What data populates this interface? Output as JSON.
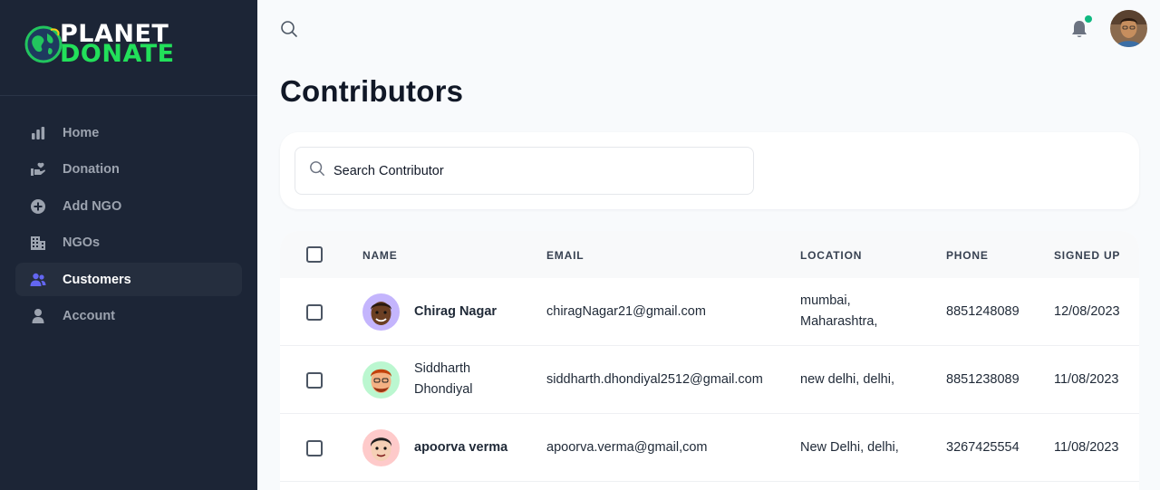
{
  "brand": {
    "line1": "PLANET",
    "line2": "DONATE"
  },
  "sidebar": {
    "items": [
      {
        "label": "Home",
        "icon": "bar-chart-icon",
        "active": false
      },
      {
        "label": "Donation",
        "icon": "hand-heart-icon",
        "active": false
      },
      {
        "label": "Add NGO",
        "icon": "plus-circle-icon",
        "active": false
      },
      {
        "label": "NGOs",
        "icon": "building-icon",
        "active": false
      },
      {
        "label": "Customers",
        "icon": "users-icon",
        "active": true
      },
      {
        "label": "Account",
        "icon": "user-icon",
        "active": false
      }
    ]
  },
  "topbar": {
    "search_icon": "search-icon",
    "bell_icon": "bell-icon",
    "notification_dot_color": "#10b981"
  },
  "page": {
    "title": "Contributors"
  },
  "search": {
    "placeholder": "Search Contributor"
  },
  "table": {
    "columns": [
      "NAME",
      "EMAIL",
      "LOCATION",
      "PHONE",
      "SIGNED UP"
    ],
    "rows": [
      {
        "name": "Chirag Nagar",
        "email": "chiragNagar21@gmail.com",
        "location": "mumbai, Maharashtra,",
        "phone": "8851248089",
        "signed_up": "12/08/2023",
        "avatar_bg": "#c4b5fd"
      },
      {
        "name": "Siddharth Dhondiyal",
        "email": "siddharth.dhondiyal2512@gmail.com",
        "location": "new delhi, delhi,",
        "phone": "8851238089",
        "signed_up": "11/08/2023",
        "avatar_bg": "#bbf7d0"
      },
      {
        "name": "apoorva verma",
        "email": "apoorva.verma@gmail,com",
        "location": "New Delhi, delhi,",
        "phone": "3267425554",
        "signed_up": "11/08/2023",
        "avatar_bg": "#fecaca"
      }
    ]
  },
  "colors": {
    "sidebar_bg": "#1c2536",
    "accent": "#6366f1",
    "brand_green": "#22e05a"
  }
}
